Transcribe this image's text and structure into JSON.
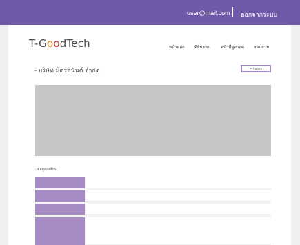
{
  "topbar": {
    "user_email": "user@mail.com",
    "logout_label": "ออกจากระบบ"
  },
  "logo": {
    "prefix": "T-G",
    "o1": "o",
    "o2": "o",
    "suffix": "dTech"
  },
  "nav": {
    "home": "หน้าหลัก",
    "tour": "ที่ยื่นขอบ",
    "latest": "หน้าที่ดูล่าสุด",
    "ask": "สอบถาม"
  },
  "company": {
    "name": "- บริษัท มิตรอนันต์ จำกัด"
  },
  "request_button": {
    "icon": "plus-icon",
    "label": "ยื่นขอบ"
  },
  "info": {
    "title": "- ข้อมูลองค์กร"
  },
  "colors": {
    "brand": "#7059a8",
    "label_cell": "#a68bc4",
    "banner": "#c4c6c7"
  }
}
